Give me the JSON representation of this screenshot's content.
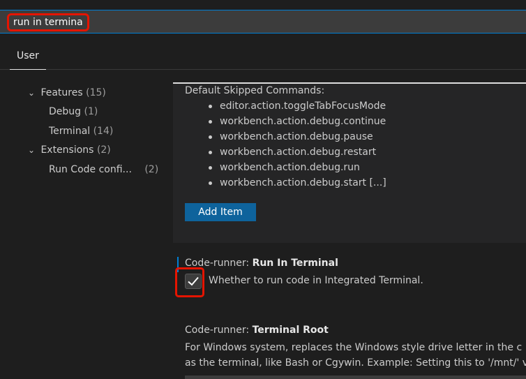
{
  "search": {
    "value": "run in terminal"
  },
  "tabs": {
    "user_label": "User"
  },
  "tree": {
    "features": {
      "label": "Features",
      "count": "(15)"
    },
    "debug": {
      "label": "Debug",
      "count": "(1)"
    },
    "terminal": {
      "label": "Terminal",
      "count": "(14)"
    },
    "extensions": {
      "label": "Extensions",
      "count": "(2)"
    },
    "run_code": {
      "label": "Run Code confi...",
      "count": "(2)"
    }
  },
  "skipped_commands": {
    "label": "Default Skipped Commands:",
    "items": [
      "editor.action.toggleTabFocusMode",
      "workbench.action.debug.continue",
      "workbench.action.debug.pause",
      "workbench.action.debug.restart",
      "workbench.action.debug.run",
      "workbench.action.debug.start [...]"
    ],
    "add_item_label": "Add Item"
  },
  "run_in_terminal": {
    "category": "Code-runner: ",
    "name": "Run In Terminal",
    "checked": true,
    "description": "Whether to run code in Integrated Terminal."
  },
  "terminal_root": {
    "category": "Code-runner: ",
    "name": "Terminal Root",
    "description_line1": "For Windows system, replaces the Windows style drive letter in the c",
    "description_line2": "as the terminal, like Bash or Cgywin. Example: Setting this to '/mnt/' v"
  },
  "colors": {
    "background": "#1e1e1e",
    "panel": "#252526",
    "accent": "#007fd4",
    "button": "#0e639c",
    "highlight_outline": "#e51400"
  }
}
